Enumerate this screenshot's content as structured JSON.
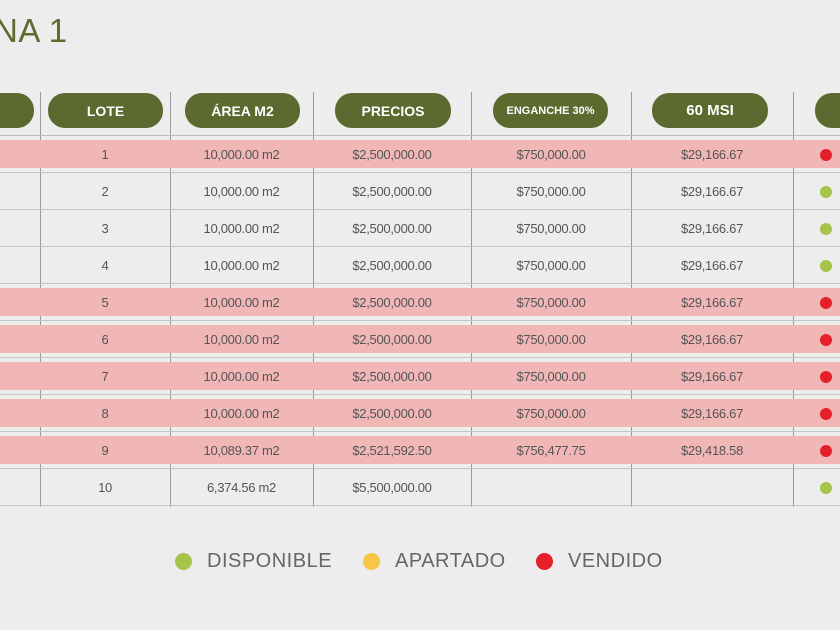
{
  "title": "NA 1",
  "colors": {
    "disponible": "#a7c44a",
    "apartado": "#f7c548",
    "vendido": "#e5202a",
    "header_pill": "#5b6a2e",
    "sold_row": "#f1b6b6"
  },
  "table": {
    "headers": {
      "first": "",
      "lote": "LOTE",
      "area": "ÁREA M2",
      "precios": "PRECIOS",
      "enganche": "ENGANCHE 30%",
      "msi": "60 MSI",
      "last": ""
    },
    "rows": [
      {
        "lote": "1",
        "area": "10,000.00 m2",
        "precio": "$2,500,000.00",
        "enganche": "$750,000.00",
        "msi": "$29,166.67",
        "status": "vendido"
      },
      {
        "lote": "2",
        "area": "10,000.00 m2",
        "precio": "$2,500,000.00",
        "enganche": "$750,000.00",
        "msi": "$29,166.67",
        "status": "disponible"
      },
      {
        "lote": "3",
        "area": "10,000.00 m2",
        "precio": "$2,500,000.00",
        "enganche": "$750,000.00",
        "msi": "$29,166.67",
        "status": "disponible"
      },
      {
        "lote": "4",
        "area": "10,000.00 m2",
        "precio": "$2,500,000.00",
        "enganche": "$750,000.00",
        "msi": "$29,166.67",
        "status": "disponible"
      },
      {
        "lote": "5",
        "area": "10,000.00 m2",
        "precio": "$2,500,000.00",
        "enganche": "$750,000.00",
        "msi": "$29,166.67",
        "status": "vendido"
      },
      {
        "lote": "6",
        "area": "10,000.00 m2",
        "precio": "$2,500,000.00",
        "enganche": "$750,000.00",
        "msi": "$29,166.67",
        "status": "vendido"
      },
      {
        "lote": "7",
        "area": "10,000.00 m2",
        "precio": "$2,500,000.00",
        "enganche": "$750,000.00",
        "msi": "$29,166.67",
        "status": "vendido"
      },
      {
        "lote": "8",
        "area": "10,000.00 m2",
        "precio": "$2,500,000.00",
        "enganche": "$750,000.00",
        "msi": "$29,166.67",
        "status": "vendido"
      },
      {
        "lote": "9",
        "area": "10,089.37 m2",
        "precio": "$2,521,592.50",
        "enganche": "$756,477.75",
        "msi": "$29,418.58",
        "status": "vendido"
      },
      {
        "lote": "10",
        "area": "6,374.56 m2",
        "precio": "$5,500,000.00",
        "enganche": "",
        "msi": "",
        "status": "disponible"
      }
    ]
  },
  "legend": [
    {
      "label": "DISPONIBLE",
      "status": "disponible"
    },
    {
      "label": "APARTADO",
      "status": "apartado"
    },
    {
      "label": "VENDIDO",
      "status": "vendido"
    }
  ]
}
